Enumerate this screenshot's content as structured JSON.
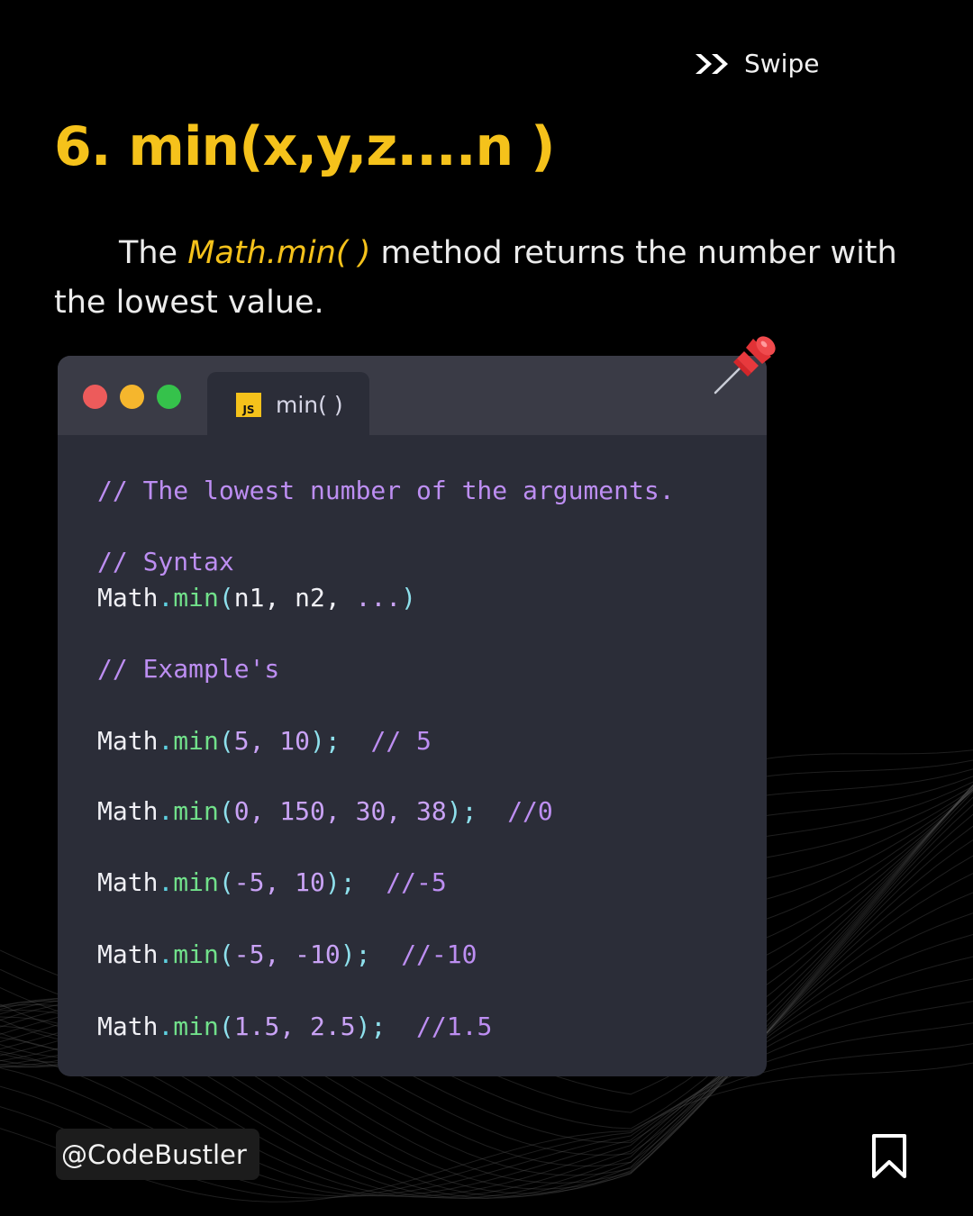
{
  "header": {
    "swipe_label": "Swipe",
    "swipe_icon": "double-chevron-right-icon"
  },
  "title": "6. min(x,y,z....n )",
  "description": {
    "prefix": "The ",
    "highlight": "Math.min( )",
    "middle": " method returns the number with",
    "line2": "the lowest value."
  },
  "code_window": {
    "tab_badge": "JS",
    "tab_label": "min( )",
    "comment_intro": "// The lowest number of the arguments.",
    "comment_syntax": "// Syntax",
    "syntax": {
      "obj": "Math",
      "dot": ".",
      "fn": "min",
      "open": "(",
      "args": "n1, n2, ",
      "rest": "...",
      "close": ")"
    },
    "comment_examples": "// Example's",
    "examples": [
      {
        "obj": "Math",
        "dot": ".",
        "fn": "min",
        "open": "(",
        "args": "5, 10",
        "close": ");",
        "comment": "// 5"
      },
      {
        "obj": "Math",
        "dot": ".",
        "fn": "min",
        "open": "(",
        "args": "0, 150, 30, 38",
        "close": ");",
        "comment": "//0"
      },
      {
        "obj": "Math",
        "dot": ".",
        "fn": "min",
        "open": "(",
        "args": "-5, 10",
        "close": ");",
        "comment": "//-5"
      },
      {
        "obj": "Math",
        "dot": ".",
        "fn": "min",
        "open": "(",
        "args": "-5, -10",
        "close": ");",
        "comment": "//-10"
      },
      {
        "obj": "Math",
        "dot": ".",
        "fn": "min",
        "open": "(",
        "args": "1.5, 2.5",
        "close": ");",
        "comment": "//1.5"
      }
    ]
  },
  "footer": {
    "handle": "@CodeBustler",
    "bookmark_icon": "bookmark-icon"
  },
  "colors": {
    "accent": "#f5c21b",
    "background": "#000000",
    "code_bg": "#2b2d38",
    "comment": "#bd8ef2",
    "function": "#71e08a",
    "punctuation": "#8ee0ec",
    "dot_red": "#ed5b5b",
    "dot_yellow": "#f5b62d",
    "dot_green": "#35c24b"
  },
  "decor": {
    "pin_icon": "pushpin-icon",
    "window_controls": "traffic-light-buttons"
  }
}
